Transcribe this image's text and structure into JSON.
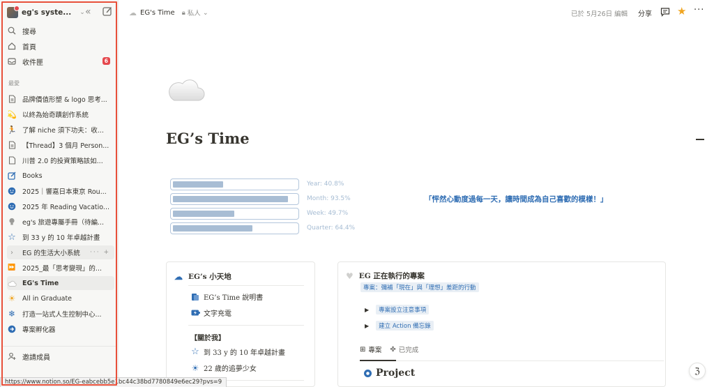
{
  "sidebar": {
    "workspace_name": "eg's syste...",
    "nav": [
      {
        "label": "搜尋",
        "icon": "search-icon"
      },
      {
        "label": "首頁",
        "icon": "home-icon"
      },
      {
        "label": "收件匣",
        "icon": "inbox-icon",
        "badge": "6"
      }
    ],
    "section_label": "最愛",
    "favorites": [
      {
        "label": "品牌價值形塑 & logo 思考...",
        "icon": "page-icon"
      },
      {
        "label": "以終為始奇蹟創作系統",
        "icon": "comet-icon"
      },
      {
        "label": "了解 niche 須下功夫：收...",
        "icon": "runner-icon"
      },
      {
        "label": "【Thread】3 個月 Person...",
        "icon": "page-icon"
      },
      {
        "label": "川普 2.0 的投資策略該如...",
        "icon": "page-icon"
      },
      {
        "label": "Books",
        "icon": "edit-icon"
      },
      {
        "label": "2025｜響嘉日本東京 Rou...",
        "icon": "smile-icon"
      },
      {
        "label": "2025 年 Reading Vacatio...",
        "icon": "smile-icon"
      },
      {
        "label": "eg's 旅遊專屬手冊（待編...",
        "icon": "lightbulb-icon"
      },
      {
        "label": "到 33 y 的 10 年卓越計畫",
        "icon": "star-icon"
      },
      {
        "label": "EG 的生活大小系統",
        "icon": "chevron-right-icon",
        "actions": "··· +"
      },
      {
        "label": "2025_最「思考變現」的...",
        "icon": "play-icon"
      },
      {
        "label": "EG's Time",
        "icon": "cloud-icon"
      },
      {
        "label": "All in Graduate",
        "icon": "sun-icon"
      },
      {
        "label": "打造一站式人生控制中心...",
        "icon": "snowflake-icon"
      },
      {
        "label": "專案孵化器",
        "icon": "arrow-circle-icon"
      }
    ],
    "invite_label": "邀請成員"
  },
  "topbar": {
    "page_name": "EG's Time",
    "privacy": "私人",
    "edited": "已於 5月26日 編輯",
    "share": "分享"
  },
  "page": {
    "title": "EG’s Time",
    "progress": [
      {
        "label": "Year: 40.8%",
        "value": 0.408
      },
      {
        "label": "Month: 93.5%",
        "value": 0.935
      },
      {
        "label": "Week: 49.7%",
        "value": 0.497
      },
      {
        "label": "Quarter: 64.4%",
        "value": 0.644
      }
    ],
    "quote": "「怦然心動度過每一天，讓時間成為自己喜歡的模樣！」",
    "left_card": {
      "title": "EG’s 小天地",
      "items": [
        {
          "label": "EG’s Time 說明書",
          "icon": "book-icon"
        },
        {
          "label": "文字充電",
          "icon": "battery-icon"
        }
      ],
      "about_label": "【關於我】",
      "about_items": [
        {
          "label": "到 33 y 的 10 年卓越計畫",
          "icon": "star-icon"
        },
        {
          "label": "22 歲的追夢少女",
          "icon": "sun-icon"
        }
      ]
    },
    "right_card": {
      "title": "EG 正在執行的專案",
      "subtitle": "專案：彌補「現在」與「理想」差距的行動",
      "toggles": [
        "專案設立注意事項",
        "建立 Action 備忘錄"
      ],
      "tabs": [
        "專案",
        "已完成"
      ],
      "section_title": "Project"
    }
  },
  "statusbar": {
    "url": "https://www.notion.so/EG-eabcebb5e1bc44c38bd7780849e6ec29?pvs=9"
  },
  "colors": {
    "accent_blue": "#2f6db3",
    "badge_red": "#e5484d",
    "star_yellow": "#f0a521",
    "highlight_outline": "#e8503a"
  }
}
